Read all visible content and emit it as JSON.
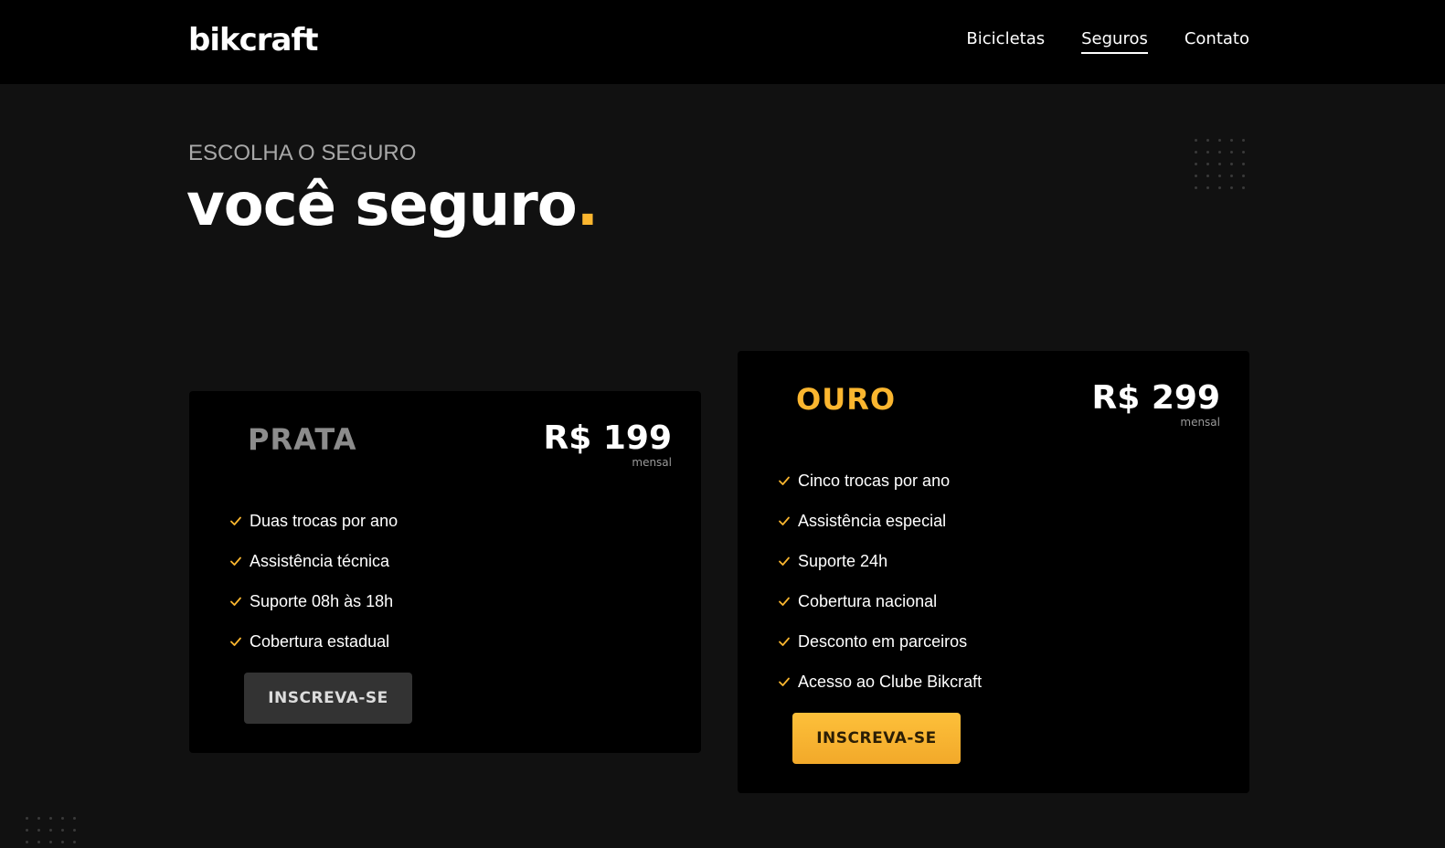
{
  "header": {
    "logo": "bikcraft",
    "nav": [
      {
        "label": "Bicicletas",
        "active": false
      },
      {
        "label": "Seguros",
        "active": true
      },
      {
        "label": "Contato",
        "active": false
      }
    ]
  },
  "hero": {
    "eyebrow": "ESCOLHA O SEGURO",
    "title": "você seguro",
    "title_dot": "."
  },
  "plans": [
    {
      "name": "PRATA",
      "price": "R$ 199",
      "period": "mensal",
      "features": [
        "Duas trocas por ano",
        "Assistência técnica",
        "Suporte 08h às 18h",
        "Cobertura estadual"
      ],
      "button": "INSCREVA-SE"
    },
    {
      "name": "OURO",
      "price": "R$ 299",
      "period": "mensal",
      "features": [
        "Cinco trocas por ano",
        "Assistência especial",
        "Suporte 24h",
        "Cobertura nacional",
        "Desconto em parceiros",
        "Acesso ao Clube Bikcraft"
      ],
      "button": "INSCREVA-SE"
    }
  ],
  "colors": {
    "accent": "#fbb62f",
    "background": "#111111",
    "card": "#000000",
    "silver_name": "#8c8c8c"
  },
  "icons": {
    "feature": "check-icon",
    "decoration": "dot-grid"
  }
}
